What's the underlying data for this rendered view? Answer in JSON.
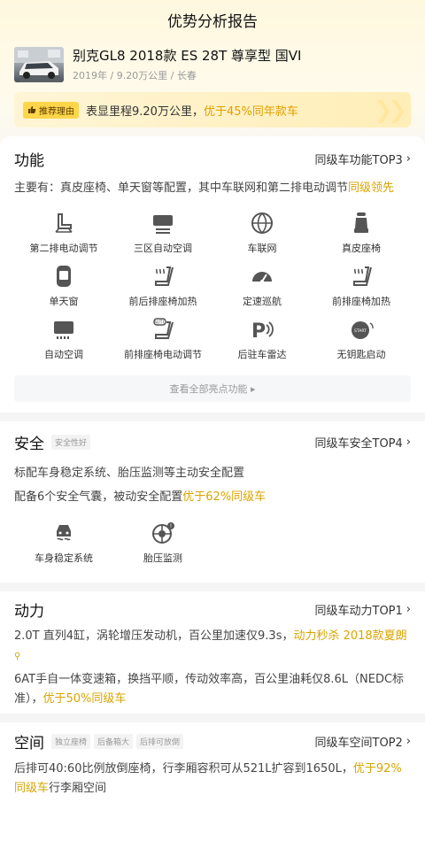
{
  "header": {
    "title": "优势分析报告"
  },
  "car": {
    "title": "别克GL8 2018款 ES 28T 尊享型 国VI",
    "meta": "2019年 / 9.20万公里 / 长春"
  },
  "reason": {
    "badge": "推荐理由",
    "text": "表显里程9.20万公里，",
    "highlight": "优于45%同年款车"
  },
  "function_section": {
    "title": "功能",
    "rank": "同级车功能TOP3",
    "desc_prefix": "主要有：真皮座椅、单天窗等配置，其中车联网和第二排电动调节",
    "desc_highlight": "同级领先",
    "features": [
      {
        "label": "第二排电动调节",
        "icon": "power-seat-icon"
      },
      {
        "label": "三区自动空调",
        "icon": "tri-zone-ac-icon"
      },
      {
        "label": "车联网",
        "icon": "connected-car-icon"
      },
      {
        "label": "真皮座椅",
        "icon": "leather-seat-icon"
      },
      {
        "label": "单天窗",
        "icon": "sunroof-icon"
      },
      {
        "label": "前后排座椅加热",
        "icon": "heated-seat-icon"
      },
      {
        "label": "定速巡航",
        "icon": "cruise-control-icon"
      },
      {
        "label": "前排座椅加热",
        "icon": "heated-front-seat-icon"
      },
      {
        "label": "自动空调",
        "icon": "auto-ac-icon"
      },
      {
        "label": "前排座椅电动调节",
        "icon": "auto-seat-icon"
      },
      {
        "label": "后驻车雷达",
        "icon": "parking-radar-icon"
      },
      {
        "label": "无钥匙启动",
        "icon": "keyless-start-icon"
      }
    ],
    "view_all": "查看全部亮点功能 ▸"
  },
  "safety_section": {
    "title": "安全",
    "tag": "安全性好",
    "rank": "同级车安全TOP4",
    "line1": "标配车身稳定系统、胎压监测等主动安全配置",
    "line2_prefix": "配备6个安全气囊，被动安全配置",
    "line2_highlight": "优于62%同级车",
    "features": [
      {
        "label": "车身稳定系统",
        "icon": "stability-control-icon"
      },
      {
        "label": "胎压监测",
        "icon": "tire-pressure-icon"
      }
    ]
  },
  "power_section": {
    "title": "动力",
    "rank": "同级车动力TOP1",
    "line1_prefix": "2.0T 直列4缸，涡轮增压发动机，百公里加速仅9.3s，",
    "line1_highlight": "动力秒杀 2018款夏朗",
    "line2_prefix": "6AT手自一体变速箱，换挡平顺，传动效率高，百公里油耗仅8.6L（NEDC标准），",
    "line2_highlight": "优于50%同级车"
  },
  "space_section": {
    "title": "空间",
    "tags": [
      "独立座椅",
      "后备箱大",
      "后排可放倒"
    ],
    "rank": "同级车空间TOP2",
    "line_prefix": "后排可40:60比例放倒座椅，行李厢容积可从521L扩容到1650L，",
    "line_highlight": "优于92%同级车",
    "line_suffix": "行李厢空间"
  },
  "colors": {
    "accent": "#d9a400",
    "badge": "#ffd54a"
  }
}
